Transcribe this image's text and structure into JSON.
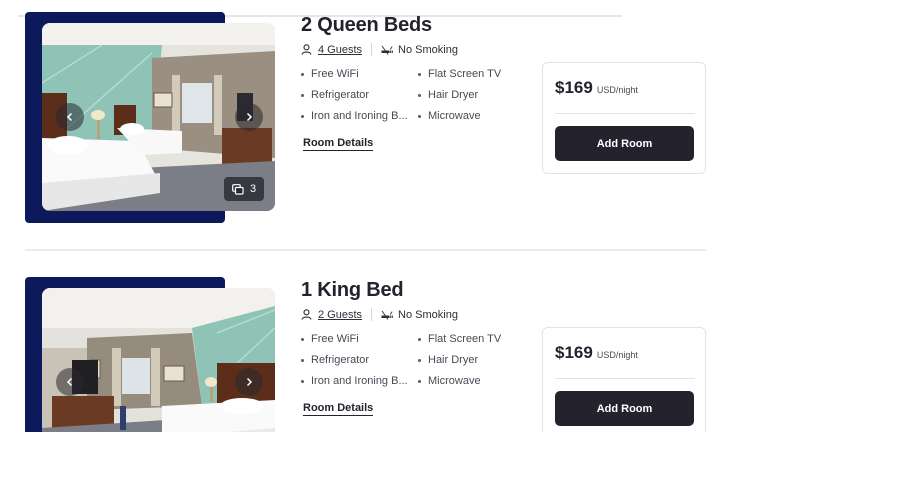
{
  "rooms": [
    {
      "title": "2 Queen Beds",
      "guests": "4 Guests",
      "smoking": "No Smoking",
      "amenities": [
        "Free WiFi",
        "Flat Screen TV",
        "Refrigerator",
        "Hair Dryer",
        "Iron and Ironing B...",
        "Microwave"
      ],
      "details_link": "Room Details",
      "photo_count": "3",
      "price": "$169",
      "price_unit": "USD/night",
      "add_button": "Add Room"
    },
    {
      "title": "1 King Bed",
      "guests": "2 Guests",
      "smoking": "No Smoking",
      "amenities": [
        "Free WiFi",
        "Flat Screen TV",
        "Refrigerator",
        "Hair Dryer",
        "Iron and Ironing B...",
        "Microwave"
      ],
      "details_link": "Room Details",
      "price": "$169",
      "price_unit": "USD/night",
      "add_button": "Add Room"
    }
  ],
  "icons": {
    "guests": "person-icon",
    "smoking": "no-smoking-icon",
    "prev": "chevron-left-icon",
    "next": "chevron-right-icon",
    "photos": "gallery-icon"
  },
  "colors": {
    "accent_navy": "#0c1a5c",
    "button_dark": "#23222d",
    "text_dark": "#23222d",
    "wall_mint": "#8fc3b5"
  }
}
